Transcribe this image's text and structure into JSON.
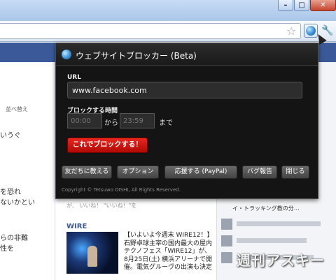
{
  "window": {
    "controls": {
      "minimize": "–",
      "maximize": "□",
      "close": "✕"
    }
  },
  "toolbar": {
    "icons": {
      "star": "star-icon",
      "extension": "website-blocker-icon",
      "wrench": "wrench-icon"
    }
  },
  "page": {
    "left_column": {
      "sort_label": "並べ替え",
      "lines": [
        "いうぐ",
        "を恐れ",
        "ないかとい",
        "らの非難",
        "性を"
      ]
    },
    "center": {
      "faded_line": "が、  いいね！  \"いいね！\"を",
      "section_title": "WIRE",
      "news_text": "【いよいよ今週末 WIRE12！】石野卓球主宰の国内最大の屋内テクノフェス「WIRE12」が、8月25日(土) 横浜アリーナで開催。電気グルーヴの出演も決定"
    },
    "right": {
      "ad_text": "イ・トラッキング教の分…"
    },
    "watermark": "週刊アスキー"
  },
  "popup": {
    "title": "ウェブサイトブロッカー (Beta)",
    "url_label": "URL",
    "url_value": "www.facebook.com",
    "time_label": "ブロックする時間",
    "start_placeholder": "00:00",
    "end_placeholder": "23:59",
    "from": "から",
    "until": "まで",
    "block_button": "これでブロックする！",
    "buttons": {
      "share": "友だちに教える",
      "options": "オプション",
      "donate": "応援する (PayPal)",
      "bug_report": "バグ報告",
      "close": "閉じる"
    },
    "copyright": "Copyright © Tetsuwo OISHI, All Rights Reserved."
  },
  "colors": {
    "popup_bg": "#141414",
    "block_button": "#d0160f",
    "facebook_blue": "#3b5998"
  }
}
